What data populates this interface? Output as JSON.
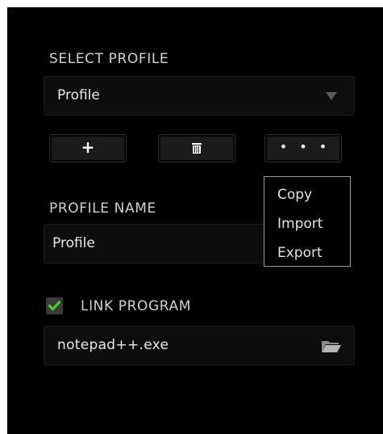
{
  "select_profile": {
    "label": "SELECT PROFILE",
    "selected_value": "Profile",
    "dropdown_icon": "caret-down-icon"
  },
  "profile_actions": {
    "add_label": "+",
    "delete_icon": "trash-icon",
    "more_label": "• • •"
  },
  "context_menu": {
    "items": [
      {
        "label": "Copy"
      },
      {
        "label": "Import"
      },
      {
        "label": "Export"
      }
    ]
  },
  "profile_name": {
    "label": "PROFILE NAME",
    "value": "Profile"
  },
  "link_program": {
    "label": "LINK PROGRAM",
    "checked": true,
    "program_value": "notepad++.exe",
    "browse_icon": "folder-icon"
  },
  "colors": {
    "background": "#000000",
    "accent_green": "#44d62c",
    "menu_border": "#9a9a9a"
  }
}
